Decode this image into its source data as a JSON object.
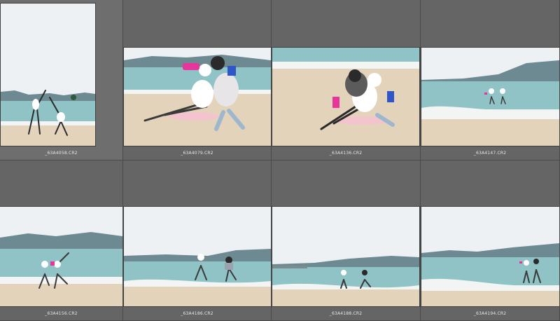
{
  "grid": {
    "items": [
      {
        "filename": "_63A4058.CR2",
        "scene": "portrait-cartwheel",
        "selected": true
      },
      {
        "filename": "_63A4079.CR2",
        "scene": "couple-sitting"
      },
      {
        "filename": "_63A4136.CR2",
        "scene": "couple-hug"
      },
      {
        "filename": "_63A4147.CR2",
        "scene": "far-splash"
      },
      {
        "filename": "_63A4156.CR2",
        "scene": "kick-splash"
      },
      {
        "filename": "_63A4186.CR2",
        "scene": "wade-splash"
      },
      {
        "filename": "_63A4188.CR2",
        "scene": "beach-run"
      },
      {
        "filename": "_63A4194.CR2",
        "scene": "shore-walk"
      }
    ]
  },
  "colors": {
    "panel_bg": "#555555",
    "cell_bg": "#656565",
    "sky": "#eef1f3",
    "mountain": "#6d8a93",
    "sea": "#8fc3c6",
    "foam": "#f2f5f3",
    "sand": "#e3d3bb"
  }
}
